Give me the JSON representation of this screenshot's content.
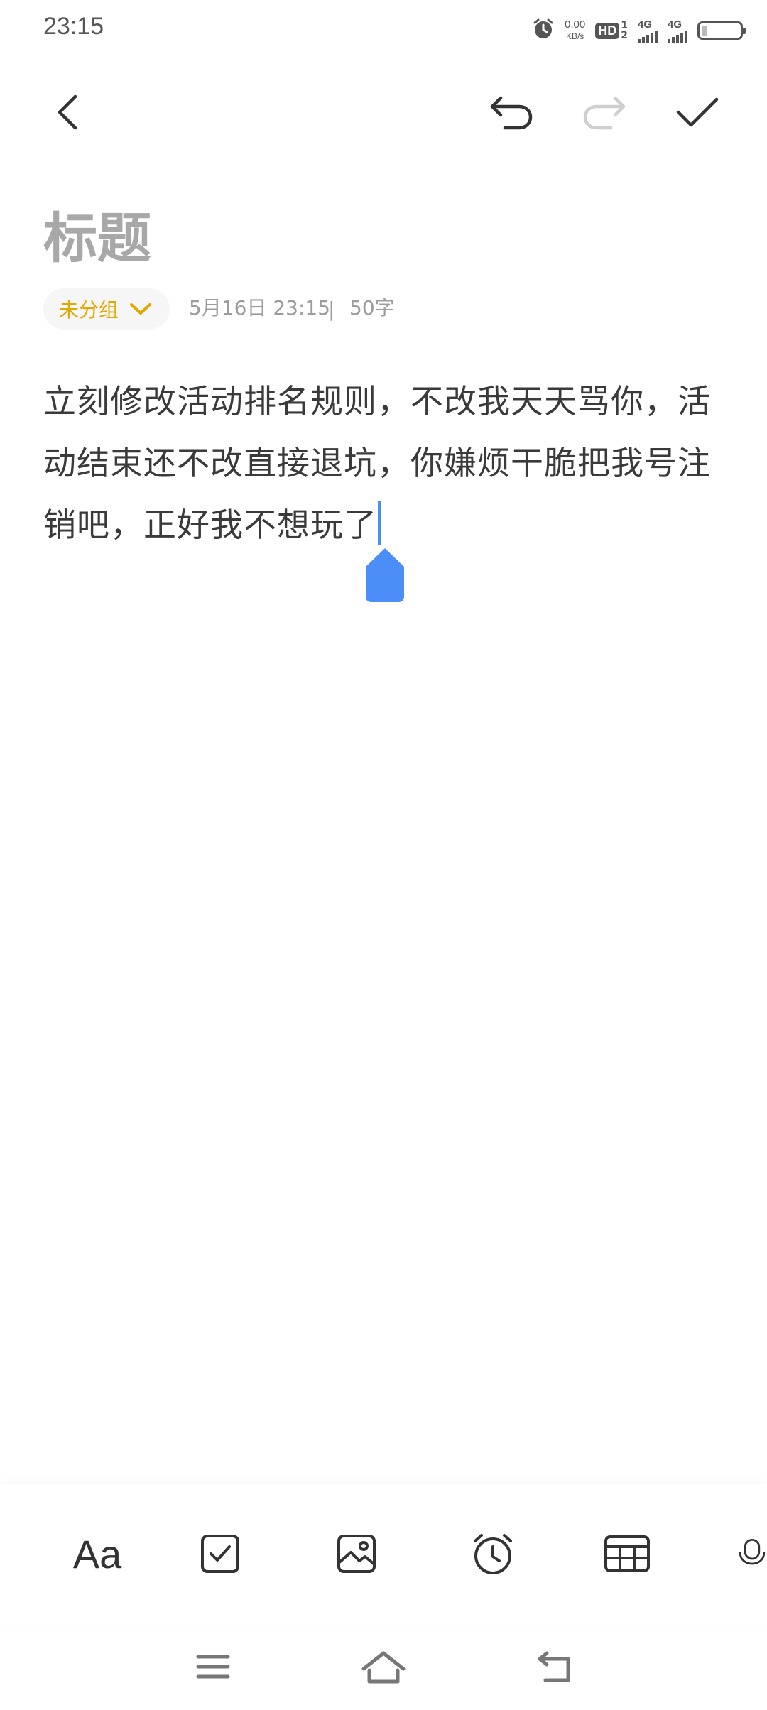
{
  "status_bar": {
    "time": "23:15",
    "net_speed_value": "0.00",
    "net_speed_unit": "KB/s",
    "hd_label": "HD",
    "hd_sim_1": "1",
    "hd_sim_2": "2",
    "signal_1_label": "4G",
    "signal_2_label": "4G",
    "battery_level": 0.15,
    "icons": [
      "alarm-icon",
      "hd-voice-icon",
      "signal-4g-icon",
      "signal-4g-icon",
      "battery-icon"
    ]
  },
  "toolbar": {
    "back_icon": "chevron-left-icon",
    "undo_icon": "undo-icon",
    "redo_icon": "redo-icon",
    "done_icon": "checkmark-icon",
    "redo_enabled": false
  },
  "note": {
    "title_placeholder": "标题",
    "category": "未分组",
    "date": "5月16日 23:15",
    "separator": "|",
    "word_count": "50字",
    "body": "立刻修改活动排名规则，不改我天天骂你，活动结束还不改直接退坑，你嫌烦干脆把我号注销吧，正好我不想玩了"
  },
  "format_bar": {
    "text_style_label": "Aa",
    "items": [
      "text-style-icon",
      "checklist-icon",
      "image-icon",
      "alarm-reminder-icon",
      "table-icon",
      "microphone-icon"
    ]
  },
  "nav_bar": {
    "items": [
      "menu-icon",
      "home-icon",
      "back-icon"
    ]
  },
  "colors": {
    "accent": "#4c8ef7",
    "category": "#e0a800",
    "title_placeholder": "#a8a8a8",
    "meta": "#9c9c9c"
  }
}
